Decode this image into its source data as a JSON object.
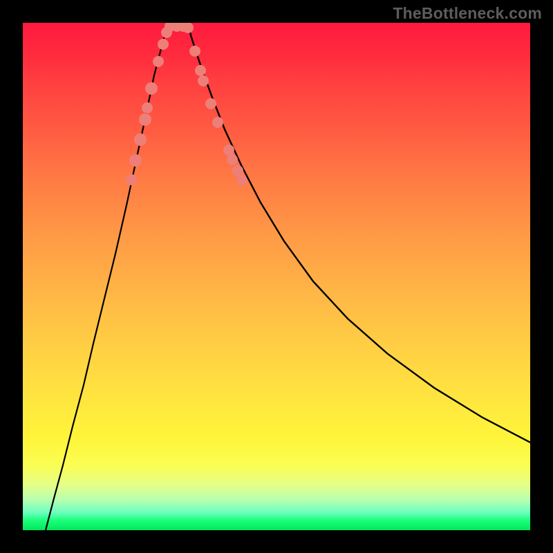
{
  "watermark": "TheBottleneck.com",
  "chart_data": {
    "type": "line",
    "title": "",
    "xlabel": "",
    "ylabel": "",
    "xlim": [
      0,
      734
    ],
    "ylim": [
      0,
      734
    ],
    "legend": false,
    "grid": false,
    "series": [
      {
        "name": "left-curve",
        "x": [
          33,
          45,
          58,
          72,
          88,
          102,
          118,
          134,
          150,
          165,
          178,
          190,
          201,
          207,
          212
        ],
        "y": [
          0,
          46,
          94,
          150,
          210,
          270,
          335,
          400,
          470,
          540,
          600,
          658,
          700,
          722,
          734
        ]
      },
      {
        "name": "right-curve",
        "x": [
          239,
          243,
          250,
          260,
          274,
          292,
          316,
          344,
          378,
          420,
          470,
          528,
          595,
          665,
          734
        ],
        "y": [
          734,
          716,
          694,
          664,
          626,
          580,
          528,
          474,
          418,
          360,
          306,
          255,
          206,
          163,
          127
        ]
      }
    ],
    "markers": [
      {
        "x": 157,
        "y": 507,
        "r": 8
      },
      {
        "x": 163,
        "y": 535,
        "r": 9
      },
      {
        "x": 170,
        "y": 565,
        "r": 9
      },
      {
        "x": 177,
        "y": 594,
        "r": 9
      },
      {
        "x": 180,
        "y": 611,
        "r": 8
      },
      {
        "x": 186,
        "y": 639,
        "r": 9
      },
      {
        "x": 196,
        "y": 678,
        "r": 8
      },
      {
        "x": 203,
        "y": 703,
        "r": 8
      },
      {
        "x": 208,
        "y": 720,
        "r": 8
      },
      {
        "x": 213,
        "y": 729,
        "r": 8
      },
      {
        "x": 223,
        "y": 729,
        "r": 8
      },
      {
        "x": 232,
        "y": 729,
        "r": 8
      },
      {
        "x": 239,
        "y": 727,
        "r": 8
      },
      {
        "x": 249,
        "y": 693,
        "r": 8
      },
      {
        "x": 257,
        "y": 665,
        "r": 8
      },
      {
        "x": 261,
        "y": 650,
        "r": 8
      },
      {
        "x": 272,
        "y": 617,
        "r": 8
      },
      {
        "x": 282,
        "y": 590,
        "r": 8
      },
      {
        "x": 298,
        "y": 550,
        "r": 8
      },
      {
        "x": 303,
        "y": 536,
        "r": 8
      },
      {
        "x": 311,
        "y": 520,
        "r": 8
      },
      {
        "x": 317,
        "y": 506,
        "r": 8
      }
    ],
    "gradient_scale": {
      "top_color": "#ff1a3f",
      "bottom_color": "#00e85c",
      "meaning": "red-high to green-low"
    },
    "marker_color": "#ed7f78",
    "curve_color": "#000000"
  }
}
